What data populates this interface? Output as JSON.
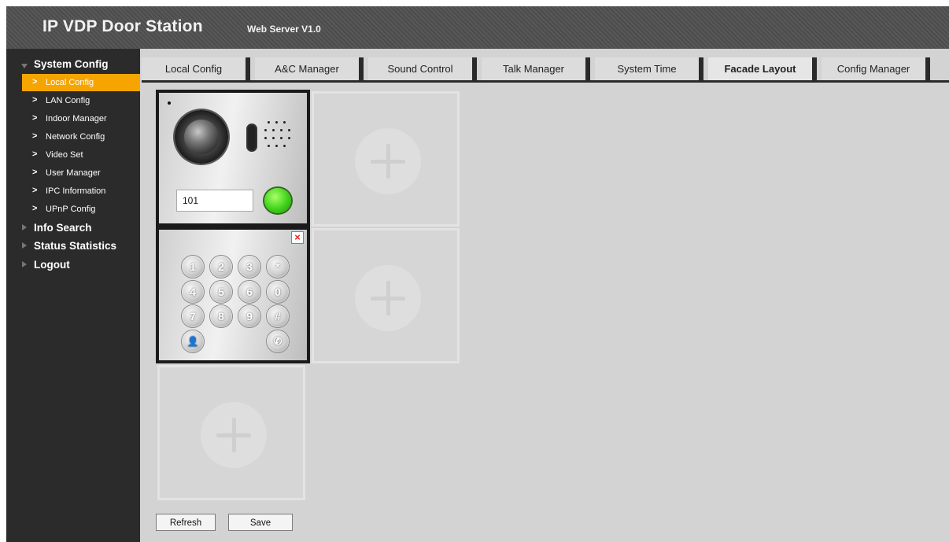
{
  "header": {
    "title": "IP VDP Door Station",
    "version": "Web Server V1.0"
  },
  "sidebar": {
    "system_config": "System Config",
    "sub_items": [
      "Local Config",
      "LAN Config",
      "Indoor Manager",
      "Network Config",
      "Video Set",
      "User Manager",
      "IPC Information",
      "UPnP Config"
    ],
    "active_sub": "Local Config",
    "info_search": "Info Search",
    "status_statistics": "Status Statistics",
    "logout": "Logout"
  },
  "tabs": [
    "Local Config",
    "A&C Manager",
    "Sound Control",
    "Talk Manager",
    "System Time",
    "Facade Layout",
    "Config Manager"
  ],
  "active_tab": "Facade Layout",
  "facade": {
    "room_number": "101",
    "keypad": [
      "1",
      "2",
      "3",
      "*",
      "4",
      "5",
      "6",
      "0",
      "7",
      "8",
      "9",
      "#",
      "👤",
      "✆"
    ],
    "close_symbol": "×",
    "add_symbol": "+"
  },
  "buttons": {
    "refresh": "Refresh",
    "save": "Save"
  },
  "colors": {
    "accent": "#f6a500",
    "sidebar_bg": "#2b2b2b",
    "call_button": "#3fd21a"
  }
}
